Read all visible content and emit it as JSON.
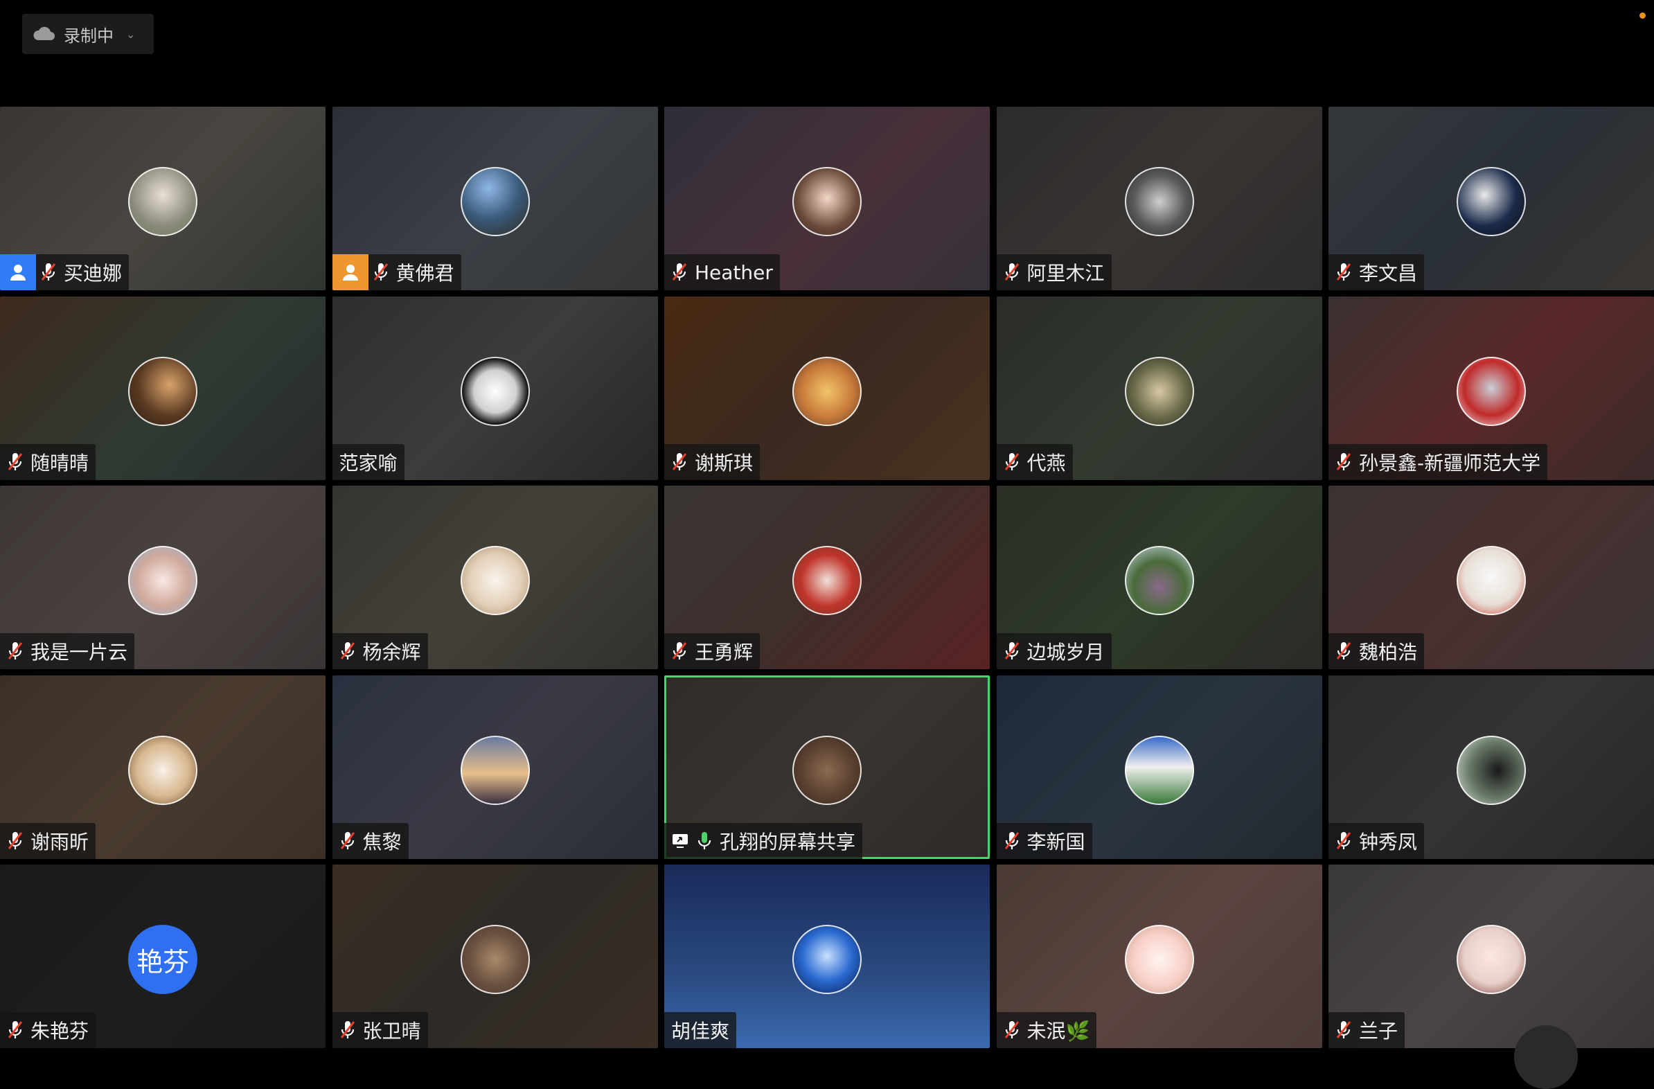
{
  "recording": {
    "label": "录制中"
  },
  "colors": {
    "active_outline": "#4cd26b",
    "host_blue": "#2f7cf6",
    "cohost_orange": "#f0962e",
    "avatar_text_bg": "#2f6ff0"
  },
  "participants": [
    {
      "name": "买迪娜",
      "mic": "muted",
      "host": "host",
      "avatar": "photo-person-icon",
      "bg": "linear-gradient(135deg,#3a3634,#4a4540 50%,#2e3630)",
      "av": "radial-gradient(circle at 50% 40%,#e8e0d4,#8a8a7a 60%,#6d7a5e)"
    },
    {
      "name": "黄佛君",
      "mic": "muted",
      "host": "cohost",
      "avatar": "photo-landscape-icon",
      "bg": "linear-gradient(135deg,#2a3036,#3a4046 50%,#353535)",
      "av": "radial-gradient(circle at 40% 30%,#8fb7e6,#3a5a7a 50%,#2e2a1e)"
    },
    {
      "name": "Heather",
      "mic": "muted",
      "host": "",
      "avatar": "cartoon-girl-icon",
      "bg": "linear-gradient(135deg,#2e2e38,#48303a 55%,#353038)",
      "av": "radial-gradient(circle at 50% 45%,#f3d7c6,#6a4a3a 60%,#3a2a28)"
    },
    {
      "name": "阿里木江",
      "mic": "muted",
      "host": "",
      "avatar": "photo-man-icon",
      "bg": "linear-gradient(135deg,#2b2b2b,#3a3432 50%,#2b2b2b)",
      "av": "radial-gradient(circle at 50% 50%,#cfcfcf,#5a5a5a 55%,#2a2a2a)"
    },
    {
      "name": "李文昌",
      "mic": "muted",
      "host": "",
      "avatar": "photo-abstract-icon",
      "bg": "linear-gradient(135deg,#34383c,#2a3038 50%,#3a3530)",
      "av": "radial-gradient(circle at 40% 40%,#eaeaea,#1a2a4a 55%,#111)"
    },
    {
      "name": "随晴晴",
      "mic": "muted",
      "host": "",
      "avatar": "photo-woman-icon",
      "bg": "linear-gradient(135deg,#3e2a1e,#2e3a32 55%,#2a2a2a)",
      "av": "radial-gradient(circle at 60% 40%,#d9a36a,#5a3a22 55%,#2a1e14)"
    },
    {
      "name": "范家喻",
      "mic": "",
      "host": "",
      "avatar": "cartoon-anime-icon",
      "bg": "linear-gradient(135deg,#2e2e2e,#3c3c3c 50%,#262626)",
      "av": "radial-gradient(circle at 50% 50%,#ffffff,#d0d0d0 45%,#111 70%)"
    },
    {
      "name": "谢斯琪",
      "mic": "muted",
      "host": "",
      "avatar": "cartoon-alice-icon",
      "bg": "linear-gradient(135deg,#4a2a12,#3a2a20 50%,#4a3220)",
      "av": "radial-gradient(circle at 50% 50%,#f2c46a,#c87a3a 55%,#5a3a2a)"
    },
    {
      "name": "代燕",
      "mic": "muted",
      "host": "",
      "avatar": "photo-hand-bird-icon",
      "bg": "linear-gradient(135deg,#2a2c28,#323a30 50%,#2a2a2a)",
      "av": "radial-gradient(circle at 50% 50%,#d8c9a6,#6a6a4a 55%,#2a2a20)"
    },
    {
      "name": "孙景鑫-新疆师范大学",
      "mic": "muted",
      "host": "",
      "avatar": "cartoon-ultraman-icon",
      "bg": "linear-gradient(135deg,#3a3030,#5a2828 50%,#3a2a2a)",
      "av": "radial-gradient(circle at 50% 45%,#c8d0d8,#c02a2a 55%,#f0f0f0)"
    },
    {
      "name": "我是一片云",
      "mic": "muted",
      "host": "",
      "avatar": "cartoon-girl-back-icon",
      "bg": "linear-gradient(135deg,#3c3634,#4a4240 50%,#3a3434)",
      "av": "radial-gradient(circle at 50% 50%,#f8e8e4,#cfa89a 55%,#8ab0d8)"
    },
    {
      "name": "杨余辉",
      "mic": "muted",
      "host": "",
      "avatar": "cartoon-family-icon",
      "bg": "linear-gradient(135deg,#343430,#444038 50%,#30302e)",
      "av": "radial-gradient(circle at 50% 50%,#faf4ec,#e2cfb8 55%,#a88a6a)"
    },
    {
      "name": "王勇辉",
      "mic": "muted",
      "host": "",
      "avatar": "photo-family-icon",
      "bg": "linear-gradient(135deg,#3a3632,#3e2e2c 50%,#5a2222)",
      "av": "radial-gradient(circle at 50% 50%,#f0e0d8,#c0342a 55%,#6a3a2a)"
    },
    {
      "name": "边城岁月",
      "mic": "muted",
      "host": "",
      "avatar": "photo-garden-icon",
      "bg": "linear-gradient(135deg,#2a2e26,#2e3a2a 50%,#2a2a26)",
      "av": "radial-gradient(circle at 50% 60%,#8a6a8a,#4a6a3a 50%,#c8d8e8)"
    },
    {
      "name": "魏柏浩",
      "mic": "muted",
      "host": "",
      "avatar": "cartoon-mario-icon",
      "bg": "linear-gradient(135deg,#3a3232,#4a3030 50%,#3a3434)",
      "av": "radial-gradient(circle at 50% 45%,#f8f8f8,#e8e0d8 55%,#c83a2a)"
    },
    {
      "name": "谢雨昕",
      "mic": "muted",
      "host": "",
      "avatar": "photo-dog-icon",
      "bg": "linear-gradient(135deg,#3a3028,#4a3a2e 50%,#3a3028)",
      "av": "radial-gradient(circle at 50% 50%,#f8f0e8,#d8b890 55%,#6a4a2a)"
    },
    {
      "name": "焦黎",
      "mic": "muted",
      "host": "",
      "avatar": "photo-sunset-icon",
      "bg": "linear-gradient(135deg,#2a3040,#3a3a44 50%,#2a2e36)",
      "av": "linear-gradient(180deg,#6a7aa0,#e8c08a 55%,#3a3040)"
    },
    {
      "name": "孔翔的屏幕共享",
      "mic": "on",
      "host": "",
      "share": true,
      "active": true,
      "avatar": "photo-tea-icon",
      "bg": "linear-gradient(135deg,#322c28,#3a3430 50%,#2e2a28)",
      "av": "radial-gradient(circle at 50% 50%,#8a6a50,#5a4030 55%,#3a2a20)"
    },
    {
      "name": "李新国",
      "mic": "muted",
      "host": "",
      "avatar": "photo-mountain-icon",
      "bg": "linear-gradient(135deg,#1e2838,#2a3440 50%,#22282e)",
      "av": "linear-gradient(180deg,#3a6ac8,#f0f0f0 45%,#3a7a3a)"
    },
    {
      "name": "钟秀凤",
      "mic": "muted",
      "host": "",
      "avatar": "photo-reading-icon",
      "bg": "linear-gradient(135deg,#2a2a2a,#343434 50%,#262626)",
      "av": "radial-gradient(circle at 60% 50%,#1a1a1a,#6a7a6a 55%,#d8e0d8)"
    },
    {
      "name": "朱艳芬",
      "mic": "muted",
      "host": "",
      "avatar_text": "艳芬",
      "avatar": "text-avatar-icon",
      "bg": "linear-gradient(135deg,#1a1a1a,#1e1e1e 50%,#1a1a1a)",
      "av": ""
    },
    {
      "name": "张卫晴",
      "mic": "muted",
      "host": "",
      "avatar": "photo-silhouette-icon",
      "bg": "linear-gradient(135deg,#3a2e24,#2e2a26 50%,#3a2e26)",
      "av": "radial-gradient(circle at 50% 50%,#a88a6a,#6a5040 55%,#4a3a2a)"
    },
    {
      "name": "胡佳爽",
      "mic": "",
      "host": "",
      "avatar": "photo-tree-icon",
      "bg": "linear-gradient(180deg,#1a2a5a,#2a4a80 60%,#3a6ab0)",
      "av": "radial-gradient(circle at 50% 45%,#c8e0ff,#2a6ad0 50%,#0a1a4a)"
    },
    {
      "name": "未泯🌿",
      "mic": "muted",
      "host": "",
      "avatar": "cartoon-mouse-icon",
      "bg": "linear-gradient(135deg,#4a3a34,#5a4440 50%,#4a3a38)",
      "av": "radial-gradient(circle at 50% 50%,#fff4f0,#f8d0c8 55%,#c89a8a)"
    },
    {
      "name": "兰子",
      "mic": "muted",
      "host": "",
      "avatar": "cartoon-girl-red-icon",
      "bg": "linear-gradient(135deg,#3a3838,#4a4444 50%,#3a3434)",
      "av": "radial-gradient(circle at 50% 45%,#fbe8e0,#e8d0c8 55%,#7a3a3a)"
    }
  ]
}
